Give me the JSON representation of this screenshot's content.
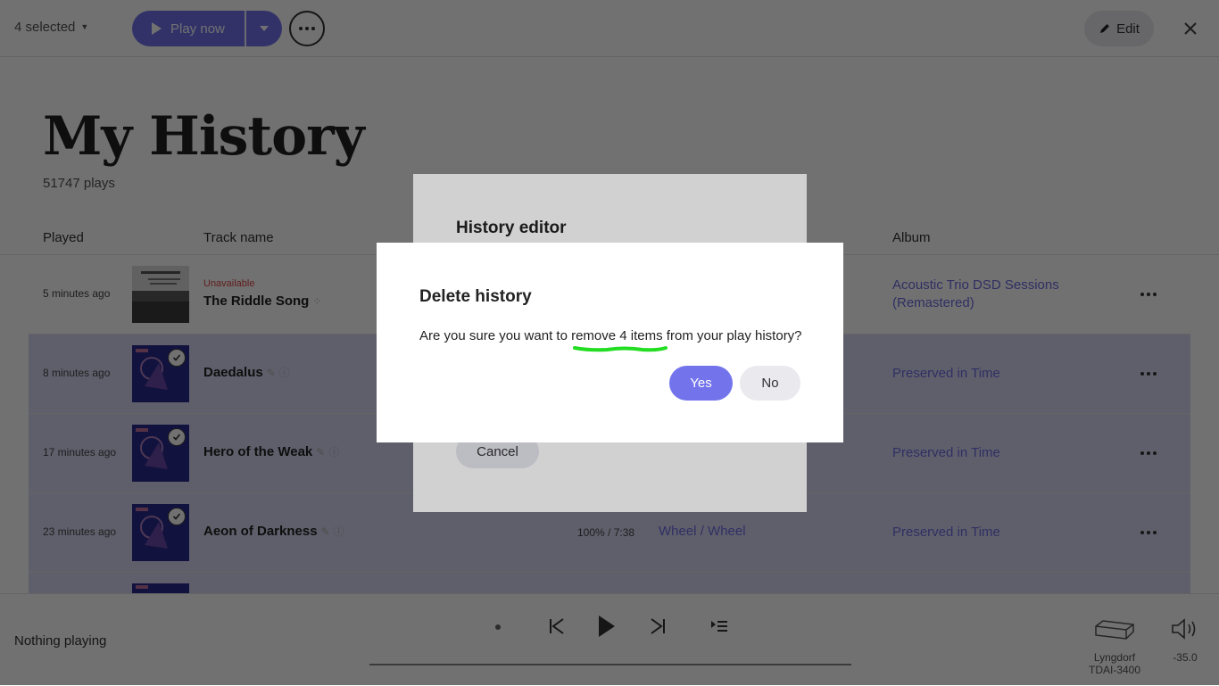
{
  "topbar": {
    "selected_label": "4 selected",
    "play_now_label": "Play now",
    "edit_label": "Edit"
  },
  "page": {
    "title": "My History",
    "plays_count": "51747 plays"
  },
  "table": {
    "columns": {
      "played": "Played",
      "track_name": "Track name",
      "album": "Album"
    },
    "rows": [
      {
        "played": "5 minutes ago",
        "status": "Unavailable",
        "track": "The Riddle Song",
        "album": "Acoustic Trio DSD Sessions (Remastered)",
        "selected": false
      },
      {
        "played": "8 minutes ago",
        "track": "Daedalus",
        "album": "Preserved in Time",
        "selected": true
      },
      {
        "played": "17 minutes ago",
        "track": "Hero of the Weak",
        "album": "Preserved in Time",
        "selected": true
      },
      {
        "played": "23 minutes ago",
        "track": "Aeon of Darkness",
        "progress_duration": "100% / 7:38",
        "artist": "Wheel",
        "artist2": "Wheel",
        "album": "Preserved in Time",
        "selected": true
      }
    ]
  },
  "footer": {
    "now_playing": "Nothing playing",
    "device_name_line1": "Lyngdorf",
    "device_name_line2": "TDAI-3400",
    "volume": "-35.0"
  },
  "history_editor": {
    "title": "History editor",
    "cancel_label": "Cancel"
  },
  "confirm_dialog": {
    "title": "Delete history",
    "message_before": "Are you sure you want to ",
    "message_highlight": "remove 4 items",
    "message_after": " from your play history?",
    "yes_label": "Yes",
    "no_label": "No",
    "annotation_color": "#22dd22"
  },
  "colors": {
    "accent": "#7374ec",
    "link": "#6b6be0",
    "selected_row": "#d9d9f4",
    "unavailable": "#dd4444"
  }
}
